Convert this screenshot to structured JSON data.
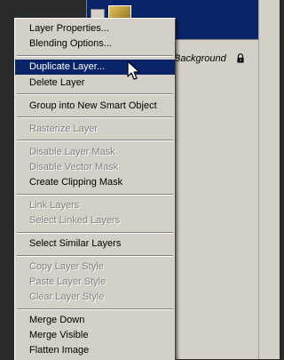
{
  "layers_panel": {
    "background_layer_label": "Background"
  },
  "menu": {
    "items": [
      {
        "label": "Layer Properties...",
        "enabled": true
      },
      {
        "label": "Blending Options...",
        "enabled": true
      },
      {
        "label": "Duplicate Layer...",
        "enabled": true,
        "highlighted": true
      },
      {
        "label": "Delete Layer",
        "enabled": true
      },
      {
        "label": "Group into New Smart Object",
        "enabled": true
      },
      {
        "label": "Rasterize Layer",
        "enabled": false
      },
      {
        "label": "Disable Layer Mask",
        "enabled": false
      },
      {
        "label": "Disable Vector Mask",
        "enabled": false
      },
      {
        "label": "Create Clipping Mask",
        "enabled": true
      },
      {
        "label": "Link Layers",
        "enabled": false
      },
      {
        "label": "Select Linked Layers",
        "enabled": false
      },
      {
        "label": "Select Similar Layers",
        "enabled": true
      },
      {
        "label": "Copy Layer Style",
        "enabled": false
      },
      {
        "label": "Paste Layer Style",
        "enabled": false
      },
      {
        "label": "Clear Layer Style",
        "enabled": false
      },
      {
        "label": "Merge Down",
        "enabled": true
      },
      {
        "label": "Merge Visible",
        "enabled": true
      },
      {
        "label": "Flatten Image",
        "enabled": true
      }
    ]
  },
  "colors": {
    "menu_bg": "#d4d0c8",
    "highlight": "#0a246a",
    "disabled_text": "#808080"
  }
}
